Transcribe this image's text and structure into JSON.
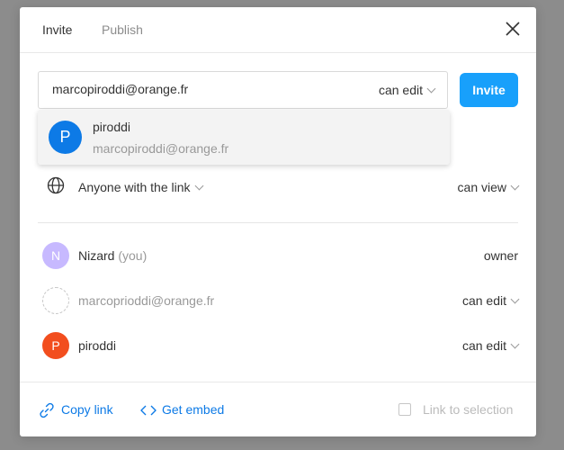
{
  "header": {
    "tabs": [
      {
        "label": "Invite",
        "active": true
      },
      {
        "label": "Publish",
        "active": false
      }
    ]
  },
  "invite": {
    "email_value": "marcopiroddi@orange.fr",
    "permission": "can edit",
    "button_label": "Invite"
  },
  "suggestion": {
    "initial": "P",
    "name": "piroddi",
    "email": "marcopiroddi@orange.fr",
    "color": "#0d7ae6"
  },
  "link_access": {
    "label": "Anyone with the link",
    "permission": "can view"
  },
  "members": [
    {
      "initial": "N",
      "name": "Nizard",
      "suffix": "(you)",
      "role": "owner",
      "color": "#c7b9ff",
      "editable": false
    },
    {
      "initial": "",
      "name": "marcoprioddi@orange.fr",
      "suffix": "",
      "role": "can edit",
      "color": "",
      "editable": true,
      "pending": true
    },
    {
      "initial": "P",
      "name": "piroddi",
      "suffix": "",
      "role": "can edit",
      "color": "#f24e1e",
      "editable": true
    }
  ],
  "footer": {
    "copy_link": "Copy link",
    "get_embed": "Get embed",
    "link_to_selection": "Link to selection"
  },
  "colors": {
    "accent": "#18a0fb",
    "link": "#0d7ae6"
  }
}
